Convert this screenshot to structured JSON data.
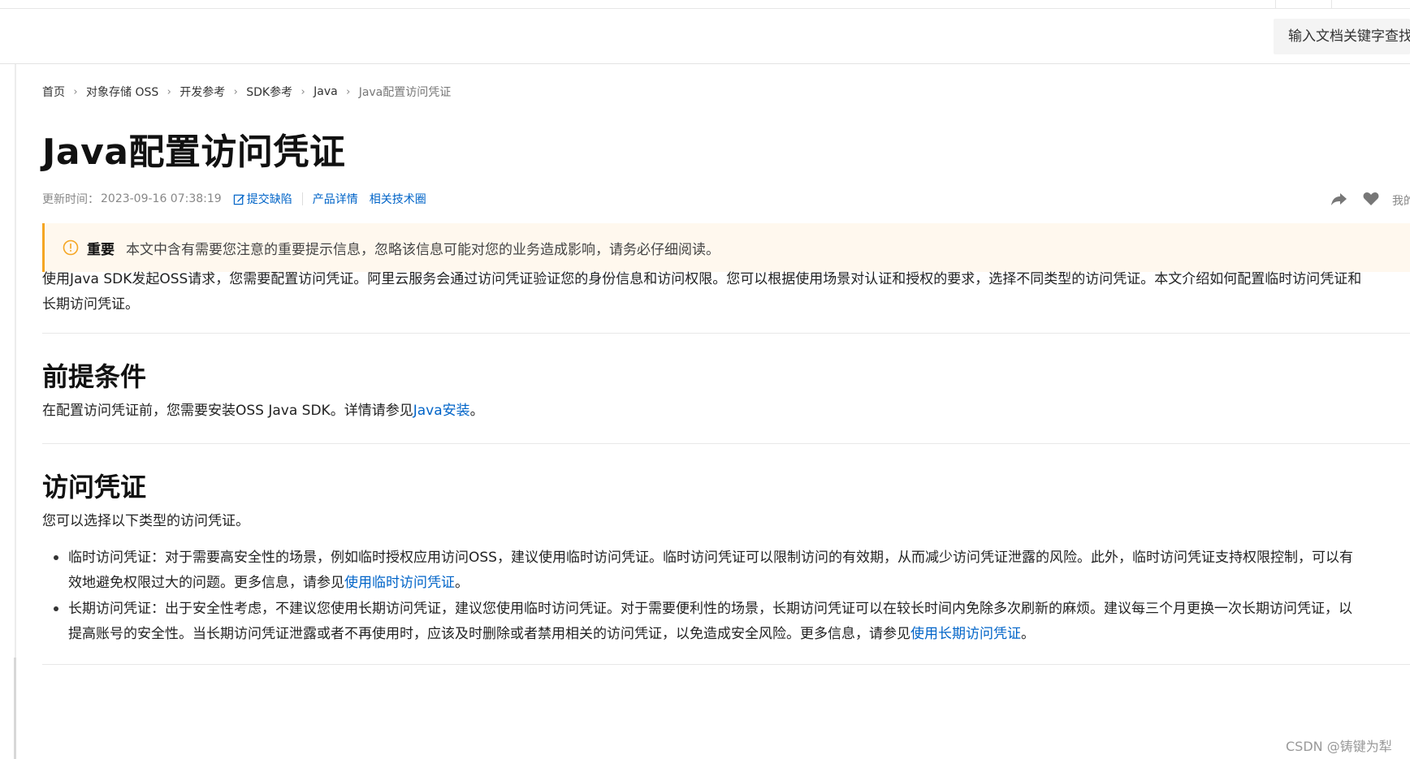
{
  "header": {
    "search_placeholder": "输入文档关键字查找"
  },
  "breadcrumb": {
    "items": [
      "首页",
      "对象存储 OSS",
      "开发参考",
      "SDK参考",
      "Java",
      "Java配置访问凭证"
    ]
  },
  "page": {
    "title": "Java配置访问凭证",
    "meta_label": "更新时间：",
    "updated": "2023-09-16 07:38:19",
    "report_link": "提交缺陷",
    "product_link": "产品详情",
    "community_link": "相关技术圈",
    "me_label": "我的"
  },
  "notice": {
    "title": "重要",
    "text": "本文中含有需要您注意的重要提示信息，忽略该信息可能对您的业务造成影响，请务必仔细阅读。"
  },
  "intro": {
    "line1": "使用Java SDK发起OSS请求，您需要配置访问凭证。阿里云服务会通过访问凭证验证您的身份信息和访问权限。您可以根据使用场景对认证和授权的要求，选择不同类型的访问凭证。本文介绍如何配置临时访问凭证和",
    "line2": "长期访问凭证。"
  },
  "prereq": {
    "heading": "前提条件",
    "text_before": "在配置访问凭证前，您需要安装OSS Java SDK。详情请参见",
    "link": "Java安装",
    "text_after": "。"
  },
  "credentials": {
    "heading": "访问凭证",
    "intro": "您可以选择以下类型的访问凭证。",
    "items": [
      {
        "line1": "临时访问凭证：对于需要高安全性的场景，例如临时授权应用访问OSS，建议使用临时访问凭证。临时访问凭证可以限制访问的有效期，从而减少访问凭证泄露的风险。此外，临时访问凭证支持权限控制，可以有",
        "line2_before": "效地避免权限过大的问题。更多信息，请参见",
        "link": "使用临时访问凭证",
        "line2_after": "。"
      },
      {
        "line1": "长期访问凭证：出于安全性考虑，不建议您使用长期访问凭证，建议您使用临时访问凭证。对于需要便利性的场景，长期访问凭证可以在较长时间内免除多次刷新的麻烦。建议每三个月更换一次长期访问凭证，以",
        "line2_before": "提高账号的安全性。当长期访问凭证泄露或者不再使用时，应该及时删除或者禁用相关的访问凭证，以免造成安全风险。更多信息，请参见",
        "link": "使用长期访问凭证",
        "line2_after": "。"
      }
    ]
  },
  "watermark": "CSDN @铸键为犁",
  "colors": {
    "link": "#0064c8",
    "notice_bg": "#fff8ee",
    "notice_accent": "#f5a623"
  }
}
